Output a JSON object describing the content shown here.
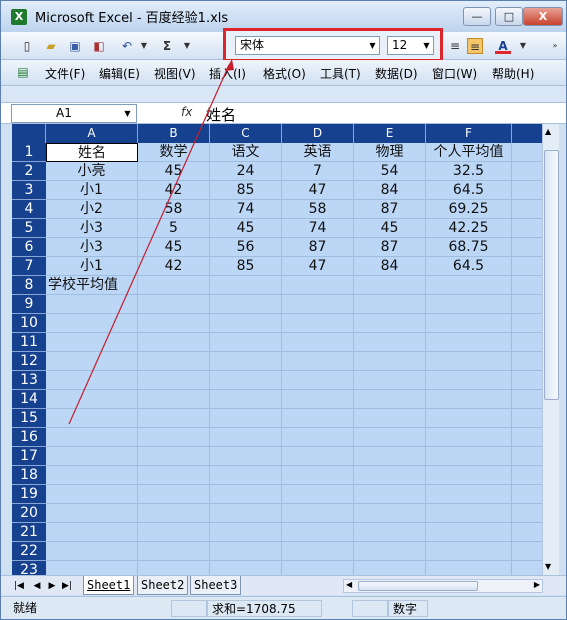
{
  "window": {
    "title": "Microsoft Excel - 百度经验1.xls",
    "app_icon": "X"
  },
  "window_controls": {
    "minimize": "—",
    "restore": "□",
    "close": "X"
  },
  "toolbar": {
    "font_name": "宋体",
    "font_size": "12",
    "sum_label": "Σ"
  },
  "menu": [
    "文件(F)",
    "编辑(E)",
    "视图(V)",
    "插入(I)",
    "格式(O)",
    "工具(T)",
    "数据(D)",
    "窗口(W)",
    "帮助(H)"
  ],
  "formula_bar": {
    "name_box": "A1",
    "fx": "fx",
    "value": "姓名"
  },
  "columns": [
    "A",
    "B",
    "C",
    "D",
    "E",
    "F"
  ],
  "rows": [
    "1",
    "2",
    "3",
    "4",
    "5",
    "6",
    "7",
    "8",
    "9",
    "10",
    "11",
    "12",
    "13",
    "14",
    "15",
    "16",
    "17",
    "18",
    "19",
    "20",
    "21",
    "22",
    "23"
  ],
  "table": [
    [
      "姓名",
      "数学",
      "语文",
      "英语",
      "物理",
      "个人平均值"
    ],
    [
      "小亮",
      "45",
      "24",
      "7",
      "54",
      "32.5"
    ],
    [
      "小1",
      "42",
      "85",
      "47",
      "84",
      "64.5"
    ],
    [
      "小2",
      "58",
      "74",
      "58",
      "87",
      "69.25"
    ],
    [
      "小3",
      "5",
      "45",
      "74",
      "45",
      "42.25"
    ],
    [
      "小3",
      "45",
      "56",
      "87",
      "87",
      "68.75"
    ],
    [
      "小1",
      "42",
      "85",
      "47",
      "84",
      "64.5"
    ],
    [
      "学校平均值",
      "",
      "",
      "",
      "",
      ""
    ]
  ],
  "sheets": [
    "Sheet1",
    "Sheet2",
    "Sheet3"
  ],
  "status": {
    "ready": "就绪",
    "sum": "求和=1708.75",
    "mode": "数字"
  },
  "colors": {
    "header_bg": "#15418f",
    "cell_bg": "#bcd6f6",
    "highlight": "#e0242c"
  }
}
